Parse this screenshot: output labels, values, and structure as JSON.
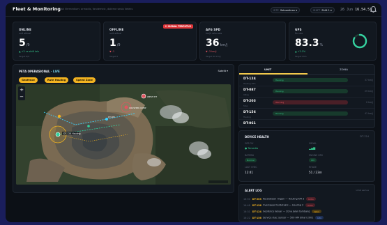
{
  "header": {
    "title": "Fleet & Monitoring",
    "subtitle": "Ulak Vermedium: armadis, fandemeic, doleme sesio Veleks",
    "site_key": "SITE",
    "site_value": "Sebuedinan",
    "shift_key": "SHIFT",
    "shift_value": "Shift 1",
    "date": "26 Jun",
    "time": "16.54.51"
  },
  "kpis": [
    {
      "label": "ONLINE",
      "sub": "unit aktual",
      "value": "5",
      "unit": "/9",
      "trend": "▲ +2 vs shift lalu",
      "note": "Target 9/9",
      "trend_color": "#35c48a"
    },
    {
      "label": "OFFLINE",
      "sub": "unit aktual",
      "value": "1",
      "unit": "/9",
      "trend": "▼ -1",
      "note": "Target 0",
      "trend_color": "#e05560",
      "badge": "!! SIGNAL TERPUTUS"
    },
    {
      "label": "AVG SPD",
      "sub": "km/h rata-rata",
      "value": "36",
      "unit": "km/j",
      "trend": "▼ -3 km/j",
      "note": "Target 40 km/j",
      "trend_color": "#e05560"
    },
    {
      "label": "GPS",
      "sub": "fix rate",
      "value": "83.3",
      "unit": "%",
      "trend": "▲ +2.1%",
      "note": "Target 95%",
      "trend_color": "#35c48a",
      "ring_fraction": 0.83
    }
  ],
  "map_panel": {
    "title": "PETA OPERASIONAL",
    "live": "· LIVE",
    "layer": "Satelit ▾",
    "chips": [
      "Geofence",
      "Rute Hauling",
      "Speed Zone"
    ],
    "zoom_in": "+",
    "zoom_out": "−",
    "markers": [
      {
        "label": "DT-124 Hauling"
      },
      {
        "label": "WEST PIT"
      },
      {
        "label": "CRUSHER DUMP"
      },
      {
        "label": "DT-087"
      }
    ]
  },
  "unit_panel": {
    "tabs": [
      "UNIT",
      "ZONA"
    ],
    "rows": [
      {
        "id": "DT-124",
        "sub": "Hauling 45%",
        "status": "Hauling",
        "status_color": "#35c48a",
        "num": "37 km/j"
      },
      {
        "id": "DT-087",
        "sub": "Idling",
        "status": "Hauling",
        "status_color": "#35c48a",
        "num": "29 km/j"
      },
      {
        "id": "DT-203",
        "sub": "Stop",
        "status": "Warning",
        "status_color": "#e05560",
        "num": "0 km/j"
      },
      {
        "id": "DT-156",
        "sub": "Hauling",
        "status": "Hauling",
        "status_color": "#35c48a",
        "num": "41 km/j"
      },
      {
        "id": "DT-061",
        "sub": "",
        "status": "",
        "status_color": "#35c48a",
        "num": ""
      }
    ]
  },
  "device_health": {
    "title": "DEVICE HEALTH",
    "unit": "DT-124",
    "fields": [
      {
        "key": "GPS FIX",
        "value": "● Tersedia"
      },
      {
        "key": "SINYAL",
        "value": "▂▄▆"
      },
      {
        "key": "BATERAI",
        "value": "Normal"
      },
      {
        "key": "ENGINE HRS",
        "value": "ON"
      },
      {
        "key": "LAST SYNC",
        "value": "12:41"
      },
      {
        "key": "RITASE",
        "value": "51 / 23m"
      }
    ]
  },
  "alert_log": {
    "title": "ALERT LOG",
    "link": "Lihat semua",
    "items": [
      {
        "time": "16:50",
        "unit": "DT-203",
        "text": "Kecelakaan ringan — Hauling KM 3",
        "level": "Kritis",
        "level_color": "#e05560"
      },
      {
        "time": "16:48",
        "unit": "DT-156",
        "text": "Overspeed terdeteksi — Hauling 2",
        "level": "Kritis",
        "level_color": "#e05560"
      },
      {
        "time": "16:31",
        "unit": "DT-124",
        "text": "Geofence keluar — Zona Jalan tambang",
        "level": "Warn",
        "level_color": "#f2b321"
      },
      {
        "time": "16:22",
        "unit": "DT-156",
        "text": "Service due: sensor — 500 HM dihari 2001",
        "level": "Info",
        "level_color": "#4a7fd6"
      }
    ]
  }
}
